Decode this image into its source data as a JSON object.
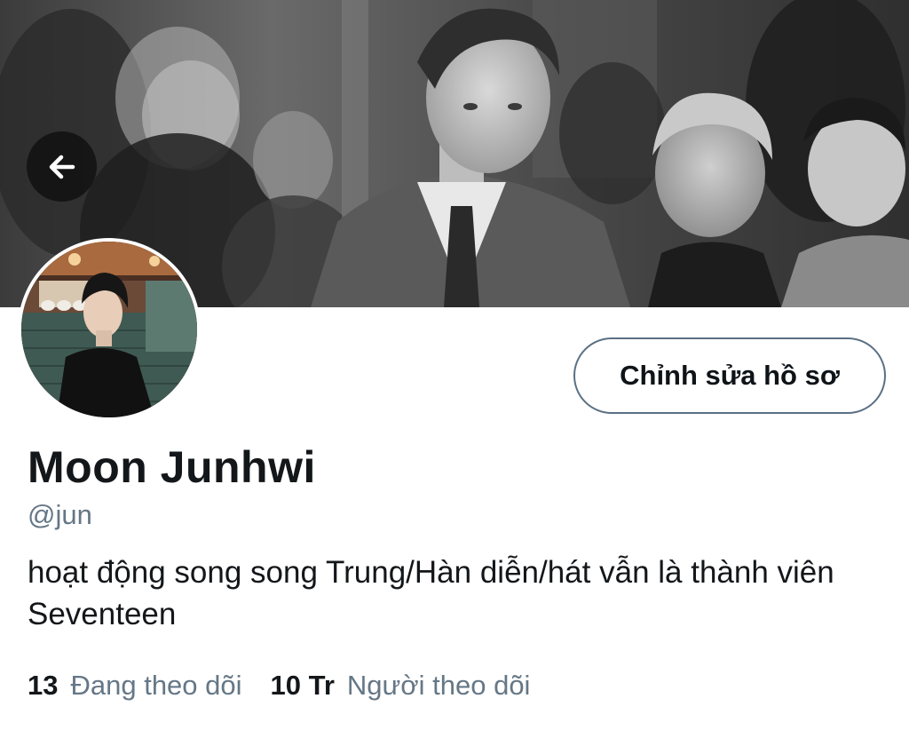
{
  "profile": {
    "display_name": "Moon Junhwi",
    "handle": "@jun",
    "bio": "hoạt động song song Trung/Hàn diễn/hát vẫn là thành viên Seventeen",
    "edit_profile_label": "Chỉnh sửa hồ sơ",
    "stats": {
      "following_count": "13",
      "following_label": "Đang theo dõi",
      "followers_count": "10 Tr",
      "followers_label": "Người theo dõi"
    }
  },
  "icons": {
    "back": "arrow-left-icon"
  },
  "colors": {
    "text_primary": "#14171a",
    "text_secondary": "#657786",
    "button_border": "#5b7083",
    "back_button_bg": "#141414"
  }
}
